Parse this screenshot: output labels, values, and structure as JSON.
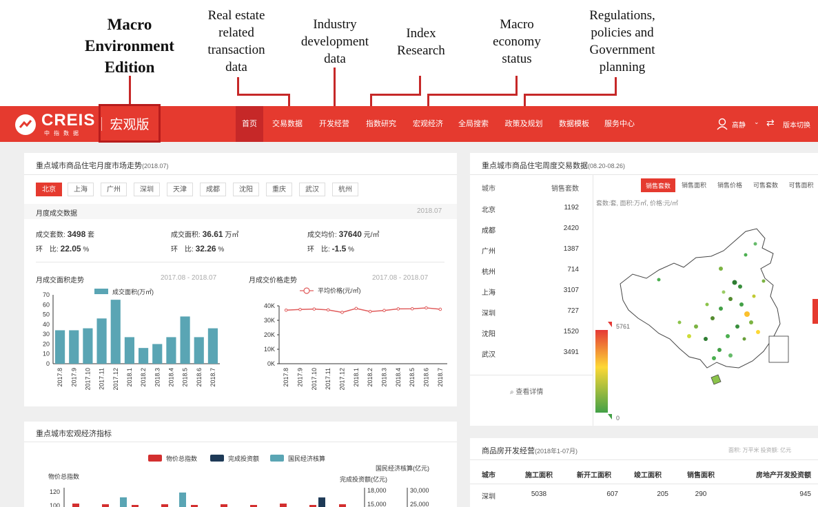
{
  "annotations": {
    "macro_edition": [
      "Macro",
      "Environment",
      "Edition"
    ],
    "real_estate": [
      "Real estate",
      "related",
      "transaction",
      "data"
    ],
    "industry": [
      "Industry",
      "development",
      "data"
    ],
    "index": [
      "Index",
      "Research"
    ],
    "macro_economy": [
      "Macro",
      "economy",
      "status"
    ],
    "regulations": [
      "Regulations,",
      "policies and",
      "Government",
      "planning"
    ]
  },
  "navbar": {
    "logo": "CREIS",
    "logo_sub": "中指数据",
    "edition": "宏观版",
    "items": [
      "首页",
      "交易数据",
      "开发经营",
      "指数研究",
      "宏观经济",
      "全局搜索",
      "政策及规划",
      "数据模板",
      "服务中心"
    ],
    "user": "高静",
    "switch": "版本切换"
  },
  "market": {
    "title": "重点城市商品住宅月度市场走势",
    "period": "(2018.07)",
    "cities": [
      "北京",
      "上海",
      "广州",
      "深圳",
      "天津",
      "成都",
      "沈阳",
      "重庆",
      "武汉",
      "杭州"
    ],
    "section_label": "月度成交数据",
    "section_date": "2018.07",
    "stats": [
      {
        "label": "成交套数:",
        "value": "3498",
        "unit": "套"
      },
      {
        "label": "成交面积:",
        "value": "36.61",
        "unit": "万㎡"
      },
      {
        "label": "成交均价:",
        "value": "37640",
        "unit": "元/㎡"
      }
    ],
    "changes": [
      {
        "label": "环　比:",
        "value": "22.05",
        "unit": "%"
      },
      {
        "label": "环　比:",
        "value": "32.26",
        "unit": "%"
      },
      {
        "label": "环　比:",
        "value": "-1.5",
        "unit": "%"
      }
    ],
    "area_trend_label": "月成交面积走势",
    "area_trend_range": "2017.08 - 2018.07",
    "price_trend_label": "月成交价格走势",
    "price_trend_range": "2017.08 - 2018.07"
  },
  "chart_data": [
    {
      "type": "bar",
      "series": [
        {
          "name": "成交面积(万㎡)",
          "values": [
            34,
            34,
            36,
            46,
            65,
            27,
            16,
            20,
            27,
            48,
            27,
            36
          ]
        }
      ],
      "categories": [
        "2017.8",
        "2017.9",
        "2017.10",
        "2017.11",
        "2017.12",
        "2018.1",
        "2018.2",
        "2018.3",
        "2018.4",
        "2018.5",
        "2018.6",
        "2018.7"
      ],
      "yticks": [
        "70",
        "60",
        "50",
        "40",
        "30",
        "20",
        "10",
        "0"
      ],
      "ylim": [
        0,
        70
      ],
      "color": "#5aa5b4"
    },
    {
      "type": "line",
      "series": [
        {
          "name": "平均价格(元/㎡)",
          "values": [
            37000,
            37500,
            37800,
            37200,
            35500,
            38200,
            36100,
            36800,
            37900,
            38000,
            38600,
            37640
          ]
        }
      ],
      "categories": [
        "2017.8",
        "2017.9",
        "2017.10",
        "2017.11",
        "2017.12",
        "2018.1",
        "2018.2",
        "2018.3",
        "2018.4",
        "2018.5",
        "2018.6",
        "2018.7"
      ],
      "yticks": [
        "40K",
        "30K",
        "20K",
        "10K",
        "0K"
      ],
      "ylim": [
        0,
        40000
      ],
      "color": "#e05a5a"
    },
    {
      "type": "bar",
      "legend": [
        "物价总指数",
        "完成投资额",
        "国民经济核算"
      ],
      "colors": [
        "#d32f2f",
        "#1e3a57",
        "#5aa5b4"
      ],
      "series": [
        {
          "name": "物价总指数",
          "values": [
            103,
            102,
            101,
            102,
            101,
            102,
            101,
            103,
            101,
            102
          ]
        },
        {
          "name": "完成投资额",
          "values": [
            0,
            0,
            0,
            0,
            0,
            0,
            0,
            0,
            7400,
            0
          ]
        },
        {
          "name": "国民经济核算",
          "values": [
            0,
            100,
            0,
            105,
            0,
            0,
            0,
            0,
            0,
            0
          ]
        }
      ],
      "ylabel": "物价总指数",
      "yticks": [
        "120",
        "100"
      ],
      "y2label": "完成投资额(亿元)",
      "y2ticks": [
        "18,000",
        "15,000"
      ],
      "y3label": "国民经济核算(亿元)",
      "y3ticks": [
        "30,000",
        "25,000"
      ]
    }
  ],
  "macro": {
    "title": "重点城市宏观经济指标"
  },
  "weekly": {
    "title": "重点城市商品住宅周度交易数据",
    "period": "(08.20-08.26)",
    "col_city": "城市",
    "col_value": "销售套数",
    "rows": [
      {
        "city": "北京",
        "value": "1192"
      },
      {
        "city": "成都",
        "value": "2420"
      },
      {
        "city": "广州",
        "value": "1387"
      },
      {
        "city": "杭州",
        "value": "714"
      },
      {
        "city": "上海",
        "value": "3107"
      },
      {
        "city": "深圳",
        "value": "727"
      },
      {
        "city": "沈阳",
        "value": "1520"
      },
      {
        "city": "武汉",
        "value": "3491"
      }
    ],
    "tabs": [
      "销售套数",
      "销售面积",
      "销售价格",
      "可售套数",
      "可售面积"
    ],
    "units": "套数:套, 面积:万㎡, 价格:元/㎡",
    "legend_max": "5761",
    "legend_min": "0",
    "view_detail": "查看详情"
  },
  "dev": {
    "title": "商品房开发经营",
    "period": "(2018年1-07月)",
    "units": "面积: 万平米  投资额: 亿元",
    "headers": [
      "城市",
      "施工面积",
      "新开工面积",
      "竣工面积",
      "销售面积",
      "房地产开发投资额"
    ],
    "rows": [
      [
        "深圳",
        "5038",
        "607",
        "205",
        "290",
        "945"
      ]
    ]
  }
}
